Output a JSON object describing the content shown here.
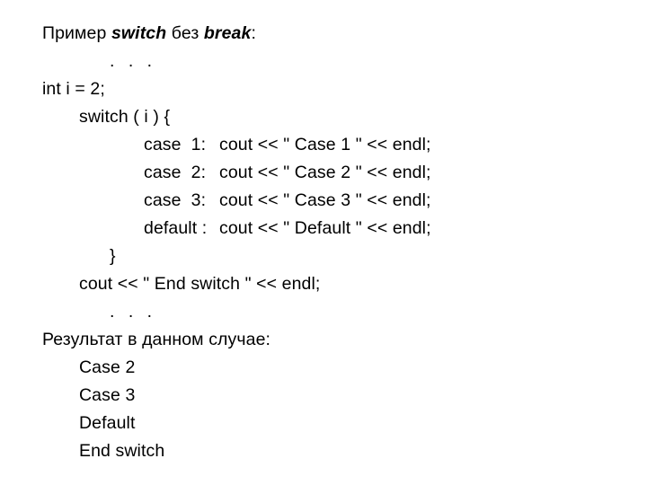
{
  "slide": {
    "background_color": "#ffffff",
    "text_color": "#000000",
    "title": {
      "prefix": "Пример ",
      "keyword1": "switch",
      "middle": " без ",
      "keyword2": "break",
      "suffix": ":"
    },
    "code": {
      "ellipsis_top": ". . .",
      "declaration": "int i = 2;",
      "switch_open": "switch ( i ) {",
      "cases": [
        {
          "label": "case  1:",
          "body": "cout << \" Case 1 \" << endl;"
        },
        {
          "label": "case  2:",
          "body": "cout << \" Case 2 \" << endl;"
        },
        {
          "label": "case  3:",
          "body": "cout << \" Case 3 \" << endl;"
        },
        {
          "label": "default :",
          "body": "cout << \" Default \" << endl;"
        }
      ],
      "switch_close": "}",
      "cout_end": "cout << \" End switch \" << endl;",
      "ellipsis_bottom": ". . ."
    },
    "result": {
      "heading": "Результат в данном случае:",
      "lines": [
        "Case 2",
        "Case 3",
        "Default",
        "End switch"
      ]
    }
  }
}
